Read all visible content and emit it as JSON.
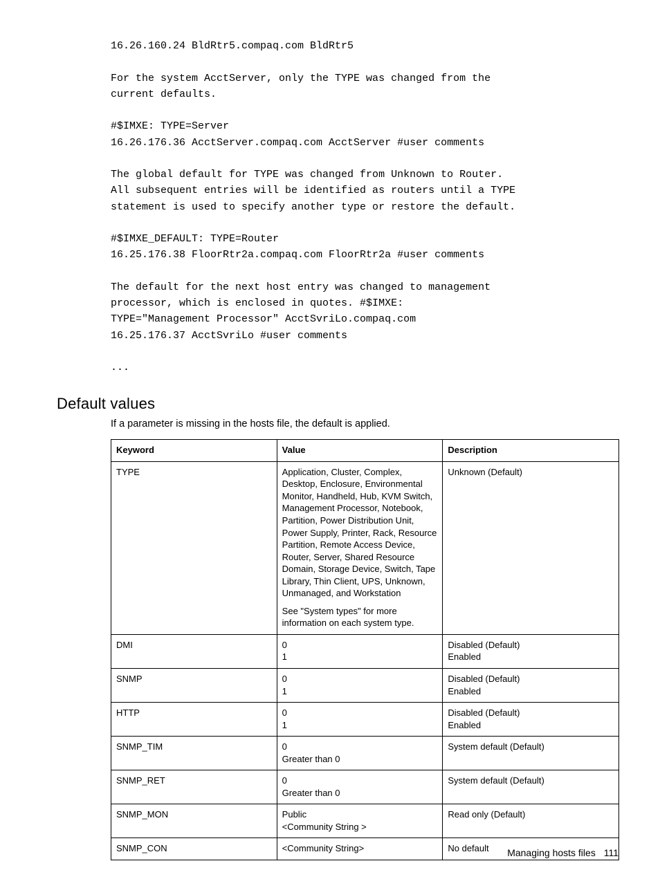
{
  "code_block": "16.26.160.24 BldRtr5.compaq.com BldRtr5\n\nFor the system AcctServer, only the TYPE was changed from the\ncurrent defaults.\n\n#$IMXE: TYPE=Server\n16.26.176.36 AcctServer.compaq.com AcctServer #user comments\n\nThe global default for TYPE was changed from Unknown to Router.\nAll subsequent entries will be identified as routers until a TYPE\nstatement is used to specify another type or restore the default.\n\n#$IMXE_DEFAULT: TYPE=Router\n16.25.176.38 FloorRtr2a.compaq.com FloorRtr2a #user comments\n\nThe default for the next host entry was changed to management\nprocessor, which is enclosed in quotes. #$IMXE:\nTYPE=\"Management Processor\" AcctSvriLo.compaq.com\n16.25.176.37 AcctSvriLo #user comments\n\n...",
  "section_heading": "Default values",
  "intro_text": "If a parameter is missing in the hosts file, the default is applied.",
  "table": {
    "headers": [
      "Keyword",
      "Value",
      "Description"
    ],
    "rows": [
      {
        "keyword": "TYPE",
        "value_main": "Application, Cluster, Complex, Desktop, Enclosure, Environmental Monitor, Handheld, Hub, KVM Switch, Management Processor, Notebook, Partition, Power Distribution Unit, Power Supply, Printer, Rack, Resource Partition, Remote Access Device, Router, Server, Shared Resource Domain, Storage Device, Switch, Tape Library, Thin Client, UPS, Unknown, Unmanaged, and Workstation",
        "value_sub_prefix": "See ",
        "value_sub_link": "\"System types\"",
        "value_sub_suffix": " for more information on each system type.",
        "description": "Unknown (Default)"
      },
      {
        "keyword": "DMI",
        "value_main": "0\n1",
        "description": "Disabled (Default)\nEnabled"
      },
      {
        "keyword": "SNMP",
        "value_main": "0\n1",
        "description": "Disabled (Default)\nEnabled"
      },
      {
        "keyword": "HTTP",
        "value_main": "0\n1",
        "description": "Disabled (Default)\nEnabled"
      },
      {
        "keyword": "SNMP_TIM",
        "value_main": "0\nGreater than 0",
        "description": "System default (Default)"
      },
      {
        "keyword": "SNMP_RET",
        "value_main": "0\nGreater than 0",
        "description": "System default (Default)"
      },
      {
        "keyword": "SNMP_MON",
        "value_main": "Public\n<Community String >",
        "description": "Read only (Default)"
      },
      {
        "keyword": "SNMP_CON",
        "value_main": "<Community String>",
        "description": "No default"
      }
    ]
  },
  "footer": {
    "text": "Managing hosts files",
    "page_number": "111"
  }
}
